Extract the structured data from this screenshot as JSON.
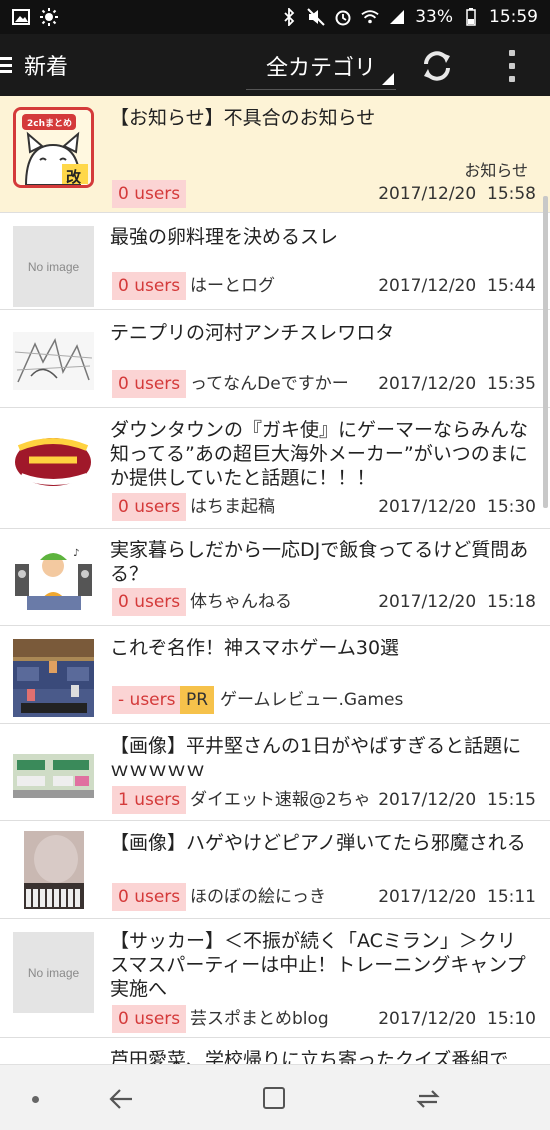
{
  "status_bar": {
    "icons_left": [
      "image-icon",
      "brightness-icon"
    ],
    "icons_right": [
      "bluetooth-icon",
      "mute-icon",
      "alarm-icon",
      "wifi-icon",
      "signal-icon"
    ],
    "battery": "33%",
    "time": "15:59"
  },
  "app_bar": {
    "title": "新着",
    "category": "全カテゴリ"
  },
  "colors": {
    "app_bar": "#1a1a1a",
    "highlight_row": "#fdf3d6",
    "users_badge_bg": "#fbd4d4",
    "users_badge_text": "#d43a3a",
    "pr_badge": "#f6c24b"
  },
  "items": [
    {
      "title": "【お知らせ】不具合のお知らせ",
      "category_label": "お知らせ",
      "users": "0 users",
      "site": "",
      "date": "2017/12/20",
      "time": "15:58",
      "thumb_label": "2chまとめ",
      "thumb_badge": "改"
    },
    {
      "title": "最強の卵料理を決めるスレ",
      "users": "0 users",
      "site": "はーとログ",
      "date": "2017/12/20",
      "time": "15:44",
      "thumb_label": "No image"
    },
    {
      "title": "テニプリの河村アンチスレワロタ",
      "users": "0 users",
      "site": "ってなんDeですかー",
      "date": "2017/12/20",
      "time": "15:35"
    },
    {
      "title": "ダウンタウンの『ガキ使』にゲーマーならみんな知ってる”あの超巨大海外メーカー”がいつのまにか提供していたと話題に！！！",
      "users": "0 users",
      "site": "はちま起稿",
      "date": "2017/12/20",
      "time": "15:30"
    },
    {
      "title": "実家暮らしだから一応DJで飯食ってるけど質問ある？",
      "users": "0 users",
      "site": "体ちゃんねる",
      "date": "2017/12/20",
      "time": "15:18"
    },
    {
      "title": "これぞ名作！神スマホゲーム30選",
      "users": "- users",
      "pr": "PR",
      "site": "ゲームレビュー.Games",
      "date": "",
      "time": ""
    },
    {
      "title": "【画像】平井堅さんの1日がやばすぎると話題にｗｗｗｗｗ",
      "users": "1 users",
      "site": "ダイエット速報@2ちゃ",
      "date": "2017/12/20",
      "time": "15:15"
    },
    {
      "title": "【画像】ハゲやけどピアノ弾いてたら邪魔される",
      "users": "0 users",
      "site": "ほのぼの絵にっき",
      "date": "2017/12/20",
      "time": "15:11"
    },
    {
      "title": "【サッカー】＜不振が続く「ACミラン」＞クリスマスパーティーは中止！トレーニングキャンプ実施へ",
      "users": "0 users",
      "site": "芸スポまとめblog",
      "date": "2017/12/20",
      "time": "15:10",
      "thumb_label": "No image"
    },
    {
      "title": "芦田愛菜、学校帰りに立ち寄ったクイズ番組で"
    }
  ]
}
